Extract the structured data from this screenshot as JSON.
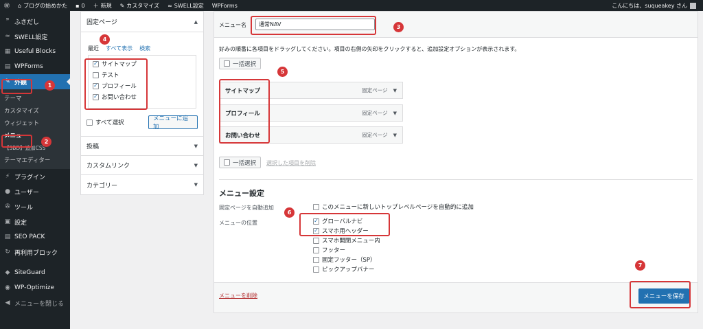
{
  "adminbar": {
    "site": "ブログの始めかた",
    "comments": "0",
    "new": "新規",
    "customize": "カスタマイズ",
    "swell": "SWELL設定",
    "wpforms": "WPForms",
    "greeting": "こんにちは、suqueakey さん"
  },
  "sidebar": {
    "items": [
      {
        "label": "ふきだし"
      },
      {
        "label": "SWELL設定"
      },
      {
        "label": "Useful Blocks"
      },
      {
        "label": "WPForms"
      },
      {
        "label": "外観"
      }
    ],
    "submenu": [
      "テーマ",
      "カスタマイズ",
      "ウィジェット",
      "メニュー",
      "【SBD】追加CSS",
      "テーマエディター"
    ],
    "items2": [
      {
        "label": "プラグイン"
      },
      {
        "label": "ユーザー"
      },
      {
        "label": "ツール"
      },
      {
        "label": "設定"
      },
      {
        "label": "SEO PACK"
      },
      {
        "label": "再利用ブロック"
      },
      {
        "label": "SiteGuard"
      },
      {
        "label": "WP-Optimize"
      },
      {
        "label": "メニューを閉じる"
      }
    ]
  },
  "left_panel": {
    "fixed_pages_title": "固定ページ",
    "tabs": [
      "最近",
      "すべて表示",
      "検索"
    ],
    "pages": [
      {
        "label": "サイトマップ",
        "checked": true
      },
      {
        "label": "テスト",
        "checked": false
      },
      {
        "label": "プロフィール",
        "checked": true
      },
      {
        "label": "お問い合わせ",
        "checked": true
      }
    ],
    "select_all": "すべて選択",
    "add_button": "メニューに追加",
    "posts": "投稿",
    "custom_links": "カスタムリンク",
    "categories": "カテゴリー"
  },
  "right_panel": {
    "menu_name_label": "メニュー名",
    "menu_name_value": "通常NAV",
    "instructions": "好みの順番に各項目をドラッグしてください。項目の右側の矢印をクリックすると、追加設定オプションが表示されます。",
    "bulk_select": "一括選択",
    "menu_items": [
      {
        "title": "サイトマップ",
        "type": "固定ページ"
      },
      {
        "title": "プロフィール",
        "type": "固定ページ"
      },
      {
        "title": "お問い合わせ",
        "type": "固定ページ"
      }
    ],
    "remove_selected": "選択した項目を削除",
    "settings_title": "メニュー設定",
    "auto_add_label": "固定ページを自動追加",
    "auto_add_option": "このメニューに新しいトップレベルページを自動的に追加",
    "location_label": "メニューの位置",
    "locations": [
      {
        "label": "グローバルナビ",
        "checked": true
      },
      {
        "label": "スマホ用ヘッダー",
        "checked": true
      },
      {
        "label": "スマホ開閉メニュー内",
        "checked": false
      },
      {
        "label": "フッター",
        "checked": false
      },
      {
        "label": "固定フッター（SP）",
        "checked": false
      },
      {
        "label": "ピックアップバナー",
        "checked": false
      }
    ],
    "delete_menu": "メニューを削除",
    "save_button": "メニューを保存"
  },
  "annotations": [
    "1",
    "2",
    "3",
    "4",
    "5",
    "6",
    "7"
  ],
  "colors": {
    "accent": "#2271b1",
    "annotation_red": "#d63638",
    "sidebar_bg": "#1d2327"
  }
}
